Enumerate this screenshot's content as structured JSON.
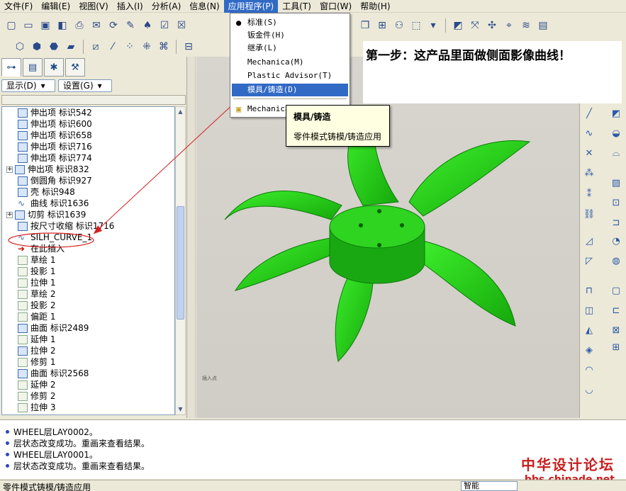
{
  "menubar": {
    "items": [
      "文件(F)",
      "编辑(E)",
      "视图(V)",
      "插入(I)",
      "分析(A)",
      "信息(N)",
      "应用程序(P)",
      "工具(T)",
      "窗口(W)",
      "帮助(H)"
    ]
  },
  "panel": {
    "display_btn": "显示(D)",
    "settings_btn": "设置(G)"
  },
  "tree": [
    {
      "label": "伸出项  标识542",
      "icon": "extrude-icon",
      "expander": ""
    },
    {
      "label": "伸出项  标识600",
      "icon": "extrude-icon",
      "expander": ""
    },
    {
      "label": "伸出项  标识658",
      "icon": "extrude-icon",
      "expander": ""
    },
    {
      "label": "伸出项  标识716",
      "icon": "extrude-icon",
      "expander": ""
    },
    {
      "label": "伸出项  标识774",
      "icon": "extrude-icon",
      "expander": ""
    },
    {
      "label": "伸出项  标识832",
      "icon": "extrude-icon",
      "expander": "+"
    },
    {
      "label": "倒圆角  标识927",
      "icon": "round-icon",
      "expander": ""
    },
    {
      "label": "壳  标识948",
      "icon": "shell-icon",
      "expander": ""
    },
    {
      "label": "曲线  标识1636",
      "icon": "curve-icon",
      "expander": ""
    },
    {
      "label": "切剪  标识1639",
      "icon": "cut-icon",
      "expander": "+"
    },
    {
      "label": "按尺寸收缩  标识1716",
      "icon": "shrink-icon",
      "expander": ""
    },
    {
      "label": "SILH_CURVE_1",
      "icon": "curve-icon",
      "expander": ""
    },
    {
      "label": "在此插入",
      "icon": "insert-arrow-icon",
      "expander": ""
    },
    {
      "label": "草绘 1",
      "icon": "sketch-icon",
      "expander": ""
    },
    {
      "label": "投影 1",
      "icon": "project-icon",
      "expander": ""
    },
    {
      "label": "拉伸 1",
      "icon": "sketch-icon",
      "expander": ""
    },
    {
      "label": "草绘 2",
      "icon": "sketch-icon",
      "expander": ""
    },
    {
      "label": "投影 2",
      "icon": "project-icon",
      "expander": ""
    },
    {
      "label": "偏距 1",
      "icon": "offset-icon",
      "expander": ""
    },
    {
      "label": "曲面  标识2489",
      "icon": "surface-icon",
      "expander": ""
    },
    {
      "label": "延伸 1",
      "icon": "extend-icon",
      "expander": ""
    },
    {
      "label": "拉伸 2",
      "icon": "extrude-icon",
      "expander": ""
    },
    {
      "label": "修剪 1",
      "icon": "trim-icon",
      "expander": ""
    },
    {
      "label": "曲面  标识2568",
      "icon": "surface-icon",
      "expander": ""
    },
    {
      "label": "延伸 2",
      "icon": "extend-icon",
      "expander": ""
    },
    {
      "label": "修剪 2",
      "icon": "trim-icon",
      "expander": ""
    },
    {
      "label": "拉伸 3",
      "icon": "sketch-icon",
      "expander": ""
    }
  ],
  "dropdown": {
    "items": [
      "标准(S)",
      "钣金件(H)",
      "继承(L)",
      "Mechanica(M)",
      "Plastic Advisor(T)",
      "模具/铸造(D)",
      "Mechanica"
    ],
    "selected_index": 5
  },
  "tooltip": {
    "title": "模具/铸造",
    "desc": "零件模式铸模/铸造应用"
  },
  "annotation": "第一步：这产品里面做侧面影像曲线！",
  "graphics": {
    "small_label": "插入点"
  },
  "messages": [
    "WHEEL层LAY0002。",
    "层状态改变成功。重画来查看结果。",
    "WHEEL层LAY0001。",
    "层状态改变成功。重画来查看结果。"
  ],
  "watermark": {
    "title": "中华设计论坛",
    "url": "bbs.chinade.net"
  },
  "status": {
    "text": "零件模式铸模/铸造应用",
    "select": "智能"
  },
  "colors": {
    "fan_green": "#22c814",
    "highlight": "#316ac5",
    "annotation_red": "#d42020"
  }
}
